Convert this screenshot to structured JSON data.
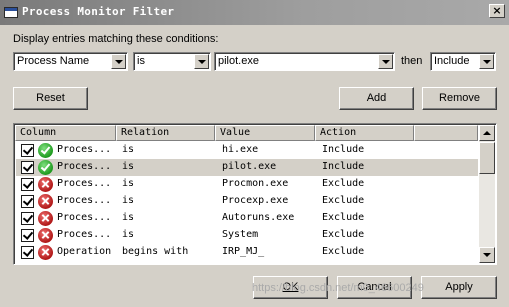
{
  "window": {
    "title": "Process Monitor Filter",
    "close_glyph": "×"
  },
  "conditions": {
    "label": "Display entries matching these conditions:",
    "column": "Process Name",
    "relation": "is",
    "value": "pilot.exe",
    "then_label": "then",
    "action": "Include"
  },
  "buttons": {
    "reset": "Reset",
    "add": "Add",
    "remove": "Remove",
    "ok": "OK",
    "cancel": "Cancel",
    "apply": "Apply"
  },
  "table": {
    "headers": [
      "Column",
      "Relation",
      "Value",
      "Action"
    ],
    "rows": [
      {
        "column": "Proces...",
        "relation": "is",
        "value": "hi.exe",
        "action": "Include",
        "status": "include",
        "checked": true,
        "selected": false
      },
      {
        "column": "Proces...",
        "relation": "is",
        "value": "pilot.exe",
        "action": "Include",
        "status": "include",
        "checked": true,
        "selected": true
      },
      {
        "column": "Proces...",
        "relation": "is",
        "value": "Procmon.exe",
        "action": "Exclude",
        "status": "exclude",
        "checked": true,
        "selected": false
      },
      {
        "column": "Proces...",
        "relation": "is",
        "value": "Procexp.exe",
        "action": "Exclude",
        "status": "exclude",
        "checked": true,
        "selected": false
      },
      {
        "column": "Proces...",
        "relation": "is",
        "value": "Autoruns.exe",
        "action": "Exclude",
        "status": "exclude",
        "checked": true,
        "selected": false
      },
      {
        "column": "Proces...",
        "relation": "is",
        "value": "System",
        "action": "Exclude",
        "status": "exclude",
        "checked": true,
        "selected": false
      },
      {
        "column": "Operation",
        "relation": "begins with",
        "value": "IRP_MJ_",
        "action": "Exclude",
        "status": "exclude",
        "checked": true,
        "selected": false
      }
    ]
  },
  "watermark": "https://blog.csdn.net/m0_46600249"
}
